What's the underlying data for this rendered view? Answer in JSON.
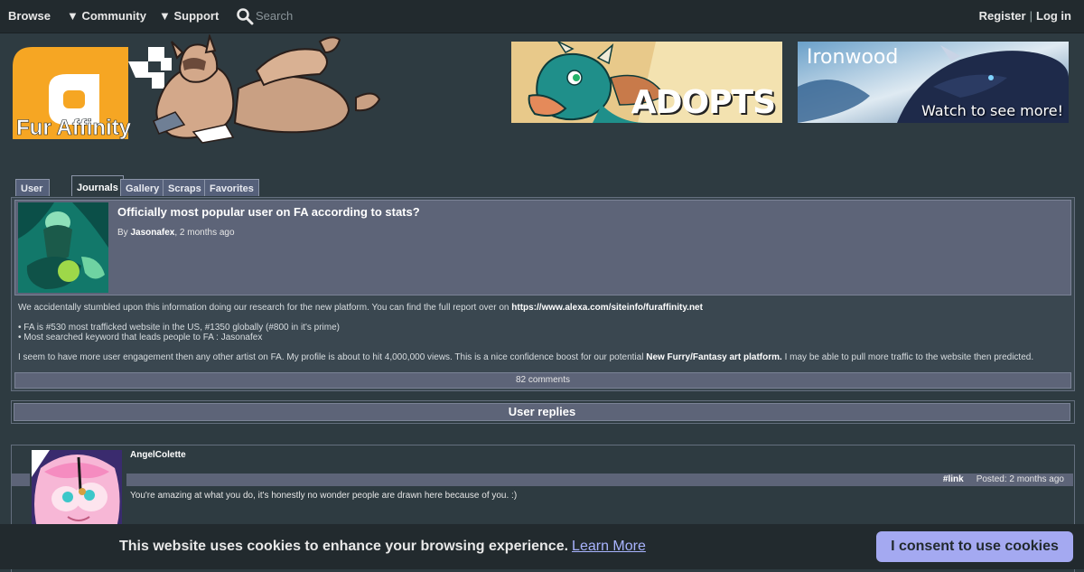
{
  "nav": {
    "browse": "Browse",
    "community": "▼ Community",
    "support": "▼ Support",
    "search_placeholder": "Search",
    "register": "Register",
    "separator": "|",
    "login": "Log in"
  },
  "logo_text": "Fur Affinity",
  "banners": {
    "left_caption": "ADOPTS",
    "right_title": "Ironwood",
    "right_caption": "Watch to see more!"
  },
  "tabs": [
    "User Page",
    "Journals",
    "Gallery",
    "Scraps",
    "Favorites"
  ],
  "journal": {
    "title": "Officially most popular user on FA according to stats?",
    "by_prefix": "By ",
    "author": "Jasonafex",
    "time": ", 2 months ago",
    "para1_text": "We accidentally stumbled upon this information doing our research for the new platform. You can find the full report over on ",
    "para1_link": "https://www.alexa.com/siteinfo/furaffinity.net",
    "bullet1": "• FA is #530 most trafficked website in the US, #1350 globally (#800 in it's prime)",
    "bullet2": "• Most searched keyword that leads people to FA : Jasonafex",
    "para3_text": "I seem to have more user engagement then any other artist on FA. My profile is about to hit 4,000,000 views. This is a nice confidence boost for our potential ",
    "para3_bold": "New Furry/Fantasy art platform.",
    "para3_end": " I may be able to pull more traffic to the website then predicted.",
    "comments": "82 comments"
  },
  "replies_header": "User replies",
  "comment": {
    "user": "AngelColette",
    "link": "#link",
    "posted": "Posted: 2 months ago",
    "text": "You're amazing at what you do, it's honestly no wonder people are drawn here because of you. :)"
  },
  "cookie": {
    "message": "This website uses cookies to enhance your browsing experience.",
    "learn_more": "Learn More",
    "button": "I consent to use cookies"
  },
  "colors": {
    "background": "#2e3b41",
    "topbar": "#222a2e",
    "panel": "#5d6478",
    "logo_orange": "#f6a623",
    "consent_button": "#a4a9f1"
  }
}
